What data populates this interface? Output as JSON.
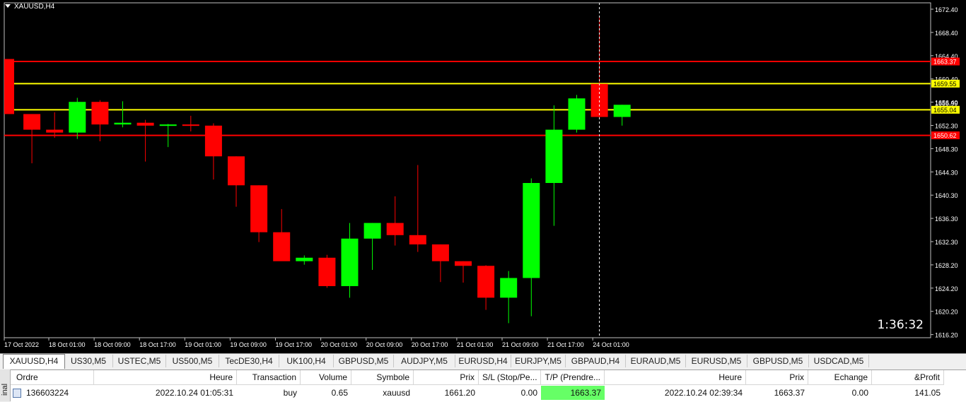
{
  "chart": {
    "symbol_label": "XAUUSD,H4",
    "countdown": "1:36:32",
    "price_ticks": [
      "1672.40",
      "1668.40",
      "1664.40",
      "1660.40",
      "1656.40",
      "1652.30",
      "1648.30",
      "1644.30",
      "1640.30",
      "1636.30",
      "1632.30",
      "1628.20",
      "1624.20",
      "1620.20",
      "1616.20"
    ],
    "time_ticks": [
      "17 Oct 2022",
      "18 Oct 01:00",
      "18 Oct 09:00",
      "18 Oct 17:00",
      "19 Oct 01:00",
      "19 Oct 09:00",
      "19 Oct 17:00",
      "20 Oct 01:00",
      "20 Oct 09:00",
      "20 Oct 17:00",
      "21 Oct 01:00",
      "21 Oct 09:00",
      "21 Oct 17:00",
      "24 Oct 01:00"
    ],
    "line_labels": [
      "1663.37",
      "1659.55",
      "1655.04",
      "1650.62"
    ],
    "partial_tick": "1655.99",
    "colors": {
      "up": "#00ff00",
      "down": "#ff0000",
      "red_line": "#ff0000",
      "yellow_line": "#ffff00",
      "background": "#000000",
      "axis": "#ffffff"
    }
  },
  "chart_data": {
    "type": "candlestick",
    "ylim": [
      1616.2,
      1672.4
    ],
    "horizontal_lines": [
      {
        "value": 1663.37,
        "color": "red"
      },
      {
        "value": 1659.55,
        "color": "yellow"
      },
      {
        "value": 1655.04,
        "color": "yellow"
      },
      {
        "value": 1650.62,
        "color": "red"
      }
    ],
    "candles": [
      {
        "o": 1663.8,
        "h": 1663.8,
        "l": 1654.3,
        "c": 1654.3
      },
      {
        "o": 1654.3,
        "h": 1654.3,
        "l": 1645.8,
        "c": 1651.6
      },
      {
        "o": 1651.6,
        "h": 1654.6,
        "l": 1650.2,
        "c": 1651.1
      },
      {
        "o": 1651.1,
        "h": 1657.1,
        "l": 1650.0,
        "c": 1656.4
      },
      {
        "o": 1656.4,
        "h": 1656.7,
        "l": 1649.6,
        "c": 1652.5
      },
      {
        "o": 1652.5,
        "h": 1656.5,
        "l": 1652.0,
        "c": 1652.8
      },
      {
        "o": 1652.8,
        "h": 1653.3,
        "l": 1646.1,
        "c": 1652.3
      },
      {
        "o": 1652.3,
        "h": 1652.6,
        "l": 1648.6,
        "c": 1652.5
      },
      {
        "o": 1652.5,
        "h": 1654.0,
        "l": 1651.3,
        "c": 1652.3
      },
      {
        "o": 1652.3,
        "h": 1652.7,
        "l": 1643.0,
        "c": 1647.0
      },
      {
        "o": 1647.0,
        "h": 1647.0,
        "l": 1638.3,
        "c": 1642.0
      },
      {
        "o": 1642.0,
        "h": 1642.0,
        "l": 1632.2,
        "c": 1633.9
      },
      {
        "o": 1633.9,
        "h": 1637.9,
        "l": 1632.6,
        "c": 1628.9
      },
      {
        "o": 1628.9,
        "h": 1629.9,
        "l": 1628.3,
        "c": 1629.5
      },
      {
        "o": 1629.5,
        "h": 1630.0,
        "l": 1624.3,
        "c": 1624.6
      },
      {
        "o": 1624.6,
        "h": 1635.5,
        "l": 1622.6,
        "c": 1632.8
      },
      {
        "o": 1632.8,
        "h": 1635.5,
        "l": 1627.4,
        "c": 1635.5
      },
      {
        "o": 1635.5,
        "h": 1640.1,
        "l": 1631.6,
        "c": 1633.4
      },
      {
        "o": 1633.4,
        "h": 1645.5,
        "l": 1630.5,
        "c": 1631.8
      },
      {
        "o": 1631.8,
        "h": 1631.8,
        "l": 1625.3,
        "c": 1628.9
      },
      {
        "o": 1628.9,
        "h": 1628.9,
        "l": 1625.2,
        "c": 1628.1
      },
      {
        "o": 1628.1,
        "h": 1628.2,
        "l": 1620.5,
        "c": 1622.6
      },
      {
        "o": 1622.6,
        "h": 1627.2,
        "l": 1618.2,
        "c": 1626.0
      },
      {
        "o": 1626.0,
        "h": 1643.2,
        "l": 1619.4,
        "c": 1642.4
      },
      {
        "o": 1642.4,
        "h": 1655.8,
        "l": 1635.0,
        "c": 1651.6
      },
      {
        "o": 1651.6,
        "h": 1657.6,
        "l": 1651.1,
        "c": 1657.0
      },
      {
        "o": 1659.5,
        "h": 1670.9,
        "l": 1653.7,
        "c": 1653.8
      },
      {
        "o": 1653.8,
        "h": 1655.9,
        "l": 1652.3,
        "c": 1655.9
      }
    ],
    "crosshair_candle_index": 26
  },
  "tabs": [
    "XAUUSD,H4",
    "US30,M5",
    "USTEC,M5",
    "US500,M5",
    "TecDE30,H4",
    "UK100,H4",
    "GBPUSD,M5",
    "AUDJPY,M5",
    "EURUSD,H4",
    "EURJPY,M5",
    "GBPAUD,H4",
    "EURAUD,M5",
    "EURUSD,M5",
    "GBPUSD,M5",
    "USDCAD,M5"
  ],
  "terminal": {
    "side_label": "inal",
    "headers": [
      "Ordre",
      "Heure",
      "Transaction",
      "Volume",
      "Symbole",
      "Prix",
      "S/L (Stop/Pe...",
      "T/P (Prendre...",
      "Heure",
      "Prix",
      "Echange",
      "&Profit"
    ],
    "row": [
      "136603224",
      "2022.10.24 01:05:31",
      "buy",
      "0.65",
      "xauusd",
      "1661.20",
      "0.00",
      "1663.37",
      "2022.10.24 02:39:34",
      "1663.37",
      "0.00",
      "141.05"
    ]
  }
}
